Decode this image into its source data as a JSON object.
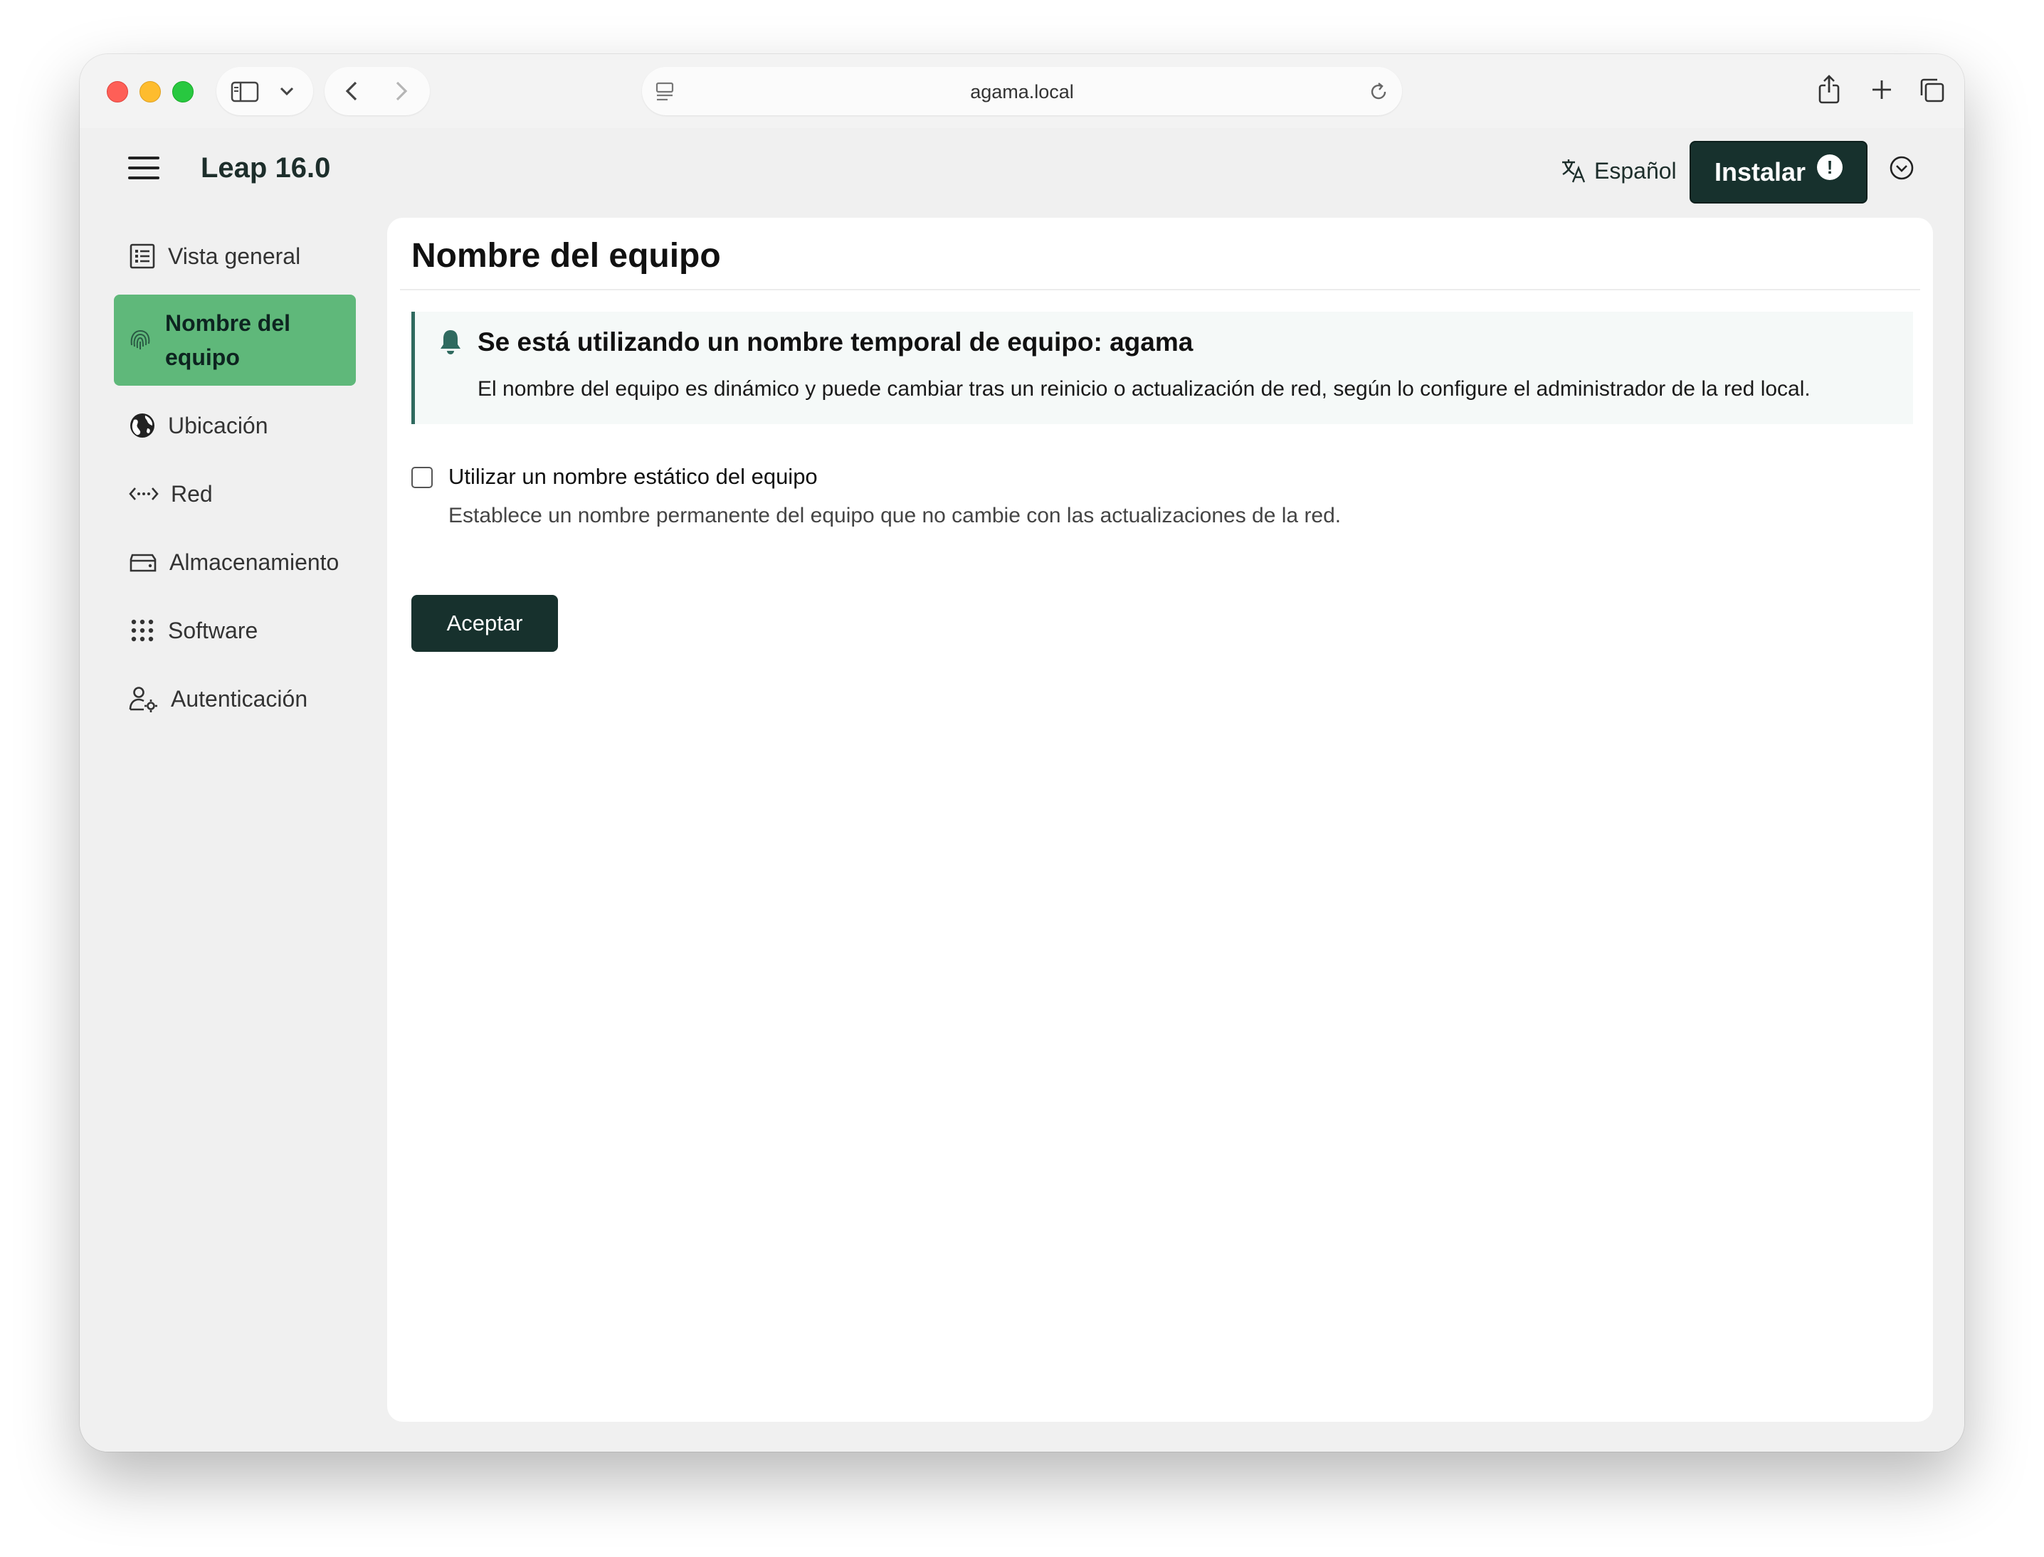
{
  "browser": {
    "url": "agama.local"
  },
  "header": {
    "product_name": "Leap 16.0",
    "language": "Español",
    "install_label": "Instalar",
    "install_warning": "!"
  },
  "sidebar": {
    "items": [
      {
        "label": "Vista general",
        "icon": "list-icon"
      },
      {
        "label": "Nombre del equipo",
        "icon": "fingerprint-icon",
        "active": true
      },
      {
        "label": "Ubicación",
        "icon": "globe-icon"
      },
      {
        "label": "Red",
        "icon": "network-icon"
      },
      {
        "label": "Almacenamiento",
        "icon": "storage-icon"
      },
      {
        "label": "Software",
        "icon": "apps-grid-icon"
      },
      {
        "label": "Autenticación",
        "icon": "user-settings-icon"
      }
    ]
  },
  "main": {
    "title": "Nombre del equipo",
    "alert": {
      "title": "Se está utilizando un nombre temporal de equipo: agama",
      "body": "El nombre del equipo es dinámico y puede cambiar tras un reinicio o actualización de red, según lo configure el administrador de la red local."
    },
    "static_hostname": {
      "label": "Utilizar un nombre estático del equipo",
      "help": "Establece un nombre permanente del equipo que no cambie con las actualizaciones de la red.",
      "checked": false
    },
    "accept_label": "Aceptar"
  },
  "colors": {
    "accent": "#5fb87a",
    "primary_dark": "#17312d",
    "alert_border": "#2f6a5f"
  }
}
